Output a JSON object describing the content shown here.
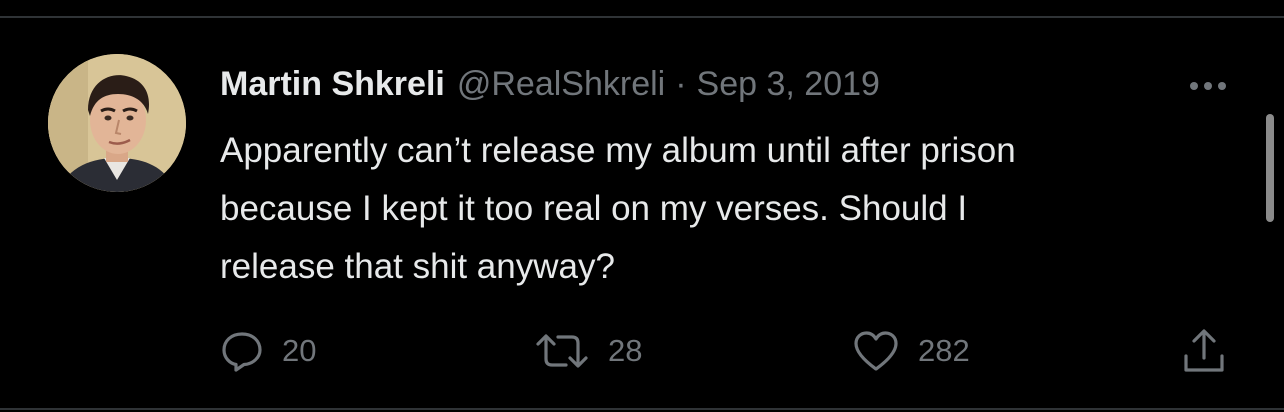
{
  "tweet": {
    "author": {
      "display_name": "Martin Shkreli",
      "handle": "@RealShkreli"
    },
    "separator": "·",
    "date": "Sep 3, 2019",
    "text": "Apparently can’t release my album until after prison\nbecause I kept it too real on my verses. Should I\nrelease that shit anyway?",
    "actions": {
      "reply_count": "20",
      "retweet_count": "28",
      "like_count": "282"
    },
    "icons": {
      "reply": "reply-icon",
      "retweet": "retweet-icon",
      "like": "heart-icon",
      "share": "share-icon",
      "more": "more-options-icon"
    }
  },
  "colors": {
    "background": "#000000",
    "primary_text": "#e7e9ea",
    "secondary_text": "#71767b",
    "divider": "#2f3336"
  }
}
